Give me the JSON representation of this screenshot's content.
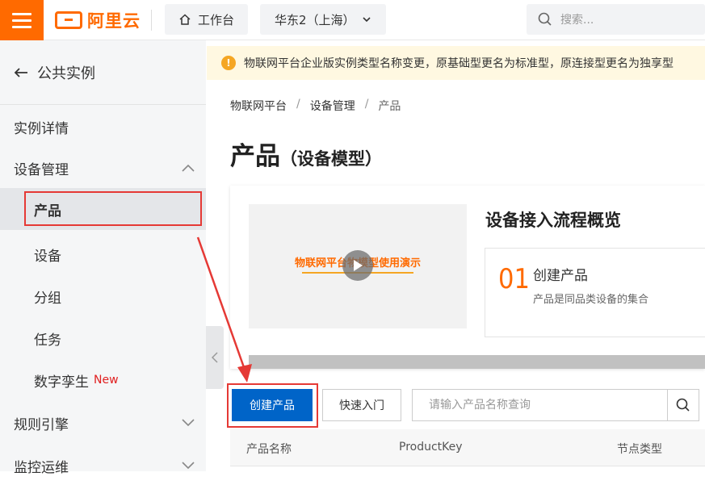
{
  "topbar": {
    "logo_text": "阿里云",
    "workbench_label": "工作台",
    "region_label": "华东2（上海）",
    "search_placeholder": "搜索..."
  },
  "sidebar": {
    "back_label": "公共实例",
    "items": [
      {
        "label": "实例详情"
      },
      {
        "label": "设备管理"
      },
      {
        "label": "产品"
      },
      {
        "label": "设备"
      },
      {
        "label": "分组"
      },
      {
        "label": "任务"
      },
      {
        "label": "数字孪生",
        "badge": "New"
      },
      {
        "label": "规则引擎"
      },
      {
        "label": "监控运维"
      }
    ]
  },
  "notice": {
    "text": "物联网平台企业版实例类型名称变更，原基础型更名为标准型，原连接型更名为独享型"
  },
  "breadcrumb": [
    "物联网平台",
    "设备管理",
    "产品"
  ],
  "page": {
    "title": "产品",
    "subtitle": "（设备模型）"
  },
  "overview": {
    "video_title": "物联网平台物模型使用演示",
    "title": "设备接入流程概览",
    "step_number": "01",
    "step_name": "创建产品",
    "step_desc": "产品是同品类设备的集合"
  },
  "toolbar": {
    "create_label": "创建产品",
    "quick_label": "快速入门",
    "search_placeholder": "请输入产品名称查询"
  },
  "table": {
    "columns": [
      "产品名称",
      "ProductKey",
      "节点类型"
    ]
  },
  "colors": {
    "brand": "#ff6a00",
    "primary": "#0064c8",
    "highlight": "#e53935"
  }
}
